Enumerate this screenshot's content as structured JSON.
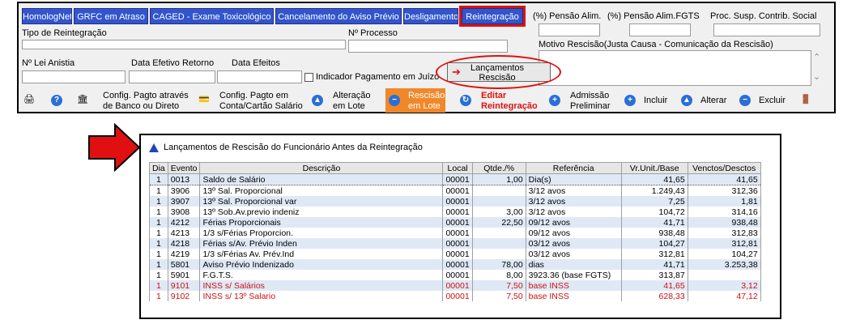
{
  "tabs": [
    {
      "label": "HomologNet"
    },
    {
      "label": "GRFC em Atraso"
    },
    {
      "label": "CAGED - Exame Toxicológico"
    },
    {
      "label": "Cancelamento do Aviso Prévio"
    },
    {
      "label": "Desligamento"
    },
    {
      "label": "Reintegração"
    }
  ],
  "form": {
    "tipo_reintegracao_label": "Tipo de Reintegração",
    "n_processo_label": "Nº Processo",
    "pensao_alim_label": "(%) Pensão Alim.",
    "pensao_fgts_label": "(%) Pensão Alim.FGTS",
    "proc_susp_label": "Proc. Susp. Contrib. Social",
    "motivo_label": "Motivo Rescisão(Justa Causa - Comunicação da Rescisão)",
    "lei_anistia_label": "Nº Lei Anistia",
    "data_retorno_label": "Data Efetivo Retorno",
    "data_efeitos_label": "Data Efeitos",
    "indicador_label": "Indicador Pagamento em Juízo",
    "lancamentos_line1": "Lançamentos",
    "lancamentos_line2": "Rescisão"
  },
  "toolbar": {
    "config_banco_1": "Config. Pagto através",
    "config_banco_2": "de Banco ou Direto",
    "config_conta_1": "Config. Pagto em",
    "config_conta_2": "Conta/Cartão Salário",
    "alteracao_1": "Alteração",
    "alteracao_2": "em Lote",
    "rescisao_1": "Rescisão",
    "rescisao_2": "em Lote",
    "editar_1": "Editar",
    "editar_2": "Reintegração",
    "admissao_1": "Admissão",
    "admissao_2": "Preliminar",
    "incluir": "Incluir",
    "alterar": "Alterar",
    "excluir": "Excluir"
  },
  "panel": {
    "title": "Lançamentos de Rescisão do Funcionário Antes da Reintegração"
  },
  "table": {
    "headers": [
      "Dia",
      "Evento",
      "Descrição",
      "Local",
      "Qtde./%",
      "Referência",
      "Vr.Unit./Base",
      "Venctos/Desctos"
    ],
    "rows": [
      {
        "dia": "1",
        "evento": "0013",
        "descricao": "Saldo de Salário",
        "local": "00001",
        "qtde": "1,00",
        "referencia": "Dia(s)",
        "vrunit": "41,65",
        "venctos": "41,65",
        "style": "sel"
      },
      {
        "dia": "1",
        "evento": "3906",
        "descricao": "13º Sal. Proporcional",
        "local": "00001",
        "qtde": "",
        "referencia": "3/12 avos",
        "vrunit": "1.249,43",
        "venctos": "312,36",
        "style": "even"
      },
      {
        "dia": "1",
        "evento": "3907",
        "descricao": "13º Sal. Proporcional var",
        "local": "00001",
        "qtde": "",
        "referencia": "3/12 avos",
        "vrunit": "7,25",
        "venctos": "1,81",
        "style": "odd"
      },
      {
        "dia": "1",
        "evento": "3908",
        "descricao": "13º Sob.Av.previo indeniz",
        "local": "00001",
        "qtde": "3,00",
        "referencia": "3/12 avos",
        "vrunit": "104,72",
        "venctos": "314,16",
        "style": "even"
      },
      {
        "dia": "1",
        "evento": "4212",
        "descricao": "Férias Proporcionais",
        "local": "00001",
        "qtde": "22,50",
        "referencia": "09/12 avos",
        "vrunit": "41,71",
        "venctos": "938,48",
        "style": "odd"
      },
      {
        "dia": "1",
        "evento": "4213",
        "descricao": "1/3 s/Férias Proporcion.",
        "local": "00001",
        "qtde": "",
        "referencia": "09/12 avos",
        "vrunit": "938,48",
        "venctos": "312,83",
        "style": "even"
      },
      {
        "dia": "1",
        "evento": "4218",
        "descricao": "Férias s/Av. Prévio Inden",
        "local": "00001",
        "qtde": "",
        "referencia": "03/12 avos",
        "vrunit": "104,27",
        "venctos": "312,81",
        "style": "odd"
      },
      {
        "dia": "1",
        "evento": "4219",
        "descricao": "1/3 s/Férias Av. Prév.Ind",
        "local": "00001",
        "qtde": "",
        "referencia": "03/12 avos",
        "vrunit": "312,81",
        "venctos": "104,27",
        "style": "even"
      },
      {
        "dia": "1",
        "evento": "5801",
        "descricao": "Aviso Prévio Indenizado",
        "local": "00001",
        "qtde": "78,00",
        "referencia": "dias",
        "vrunit": "41,71",
        "venctos": "3.253,38",
        "style": "odd"
      },
      {
        "dia": "1",
        "evento": "5901",
        "descricao": "F.G.T.S.",
        "local": "00001",
        "qtde": "8,00",
        "referencia": "3923.36 (base FGTS)",
        "vrunit": "313,87",
        "venctos": "",
        "style": "even"
      },
      {
        "dia": "1",
        "evento": "9101",
        "descricao": "INSS s/ Salários",
        "local": "00001",
        "qtde": "7,50",
        "referencia": "base INSS",
        "vrunit": "41,65",
        "venctos": "3,12",
        "style": "odd neg"
      },
      {
        "dia": "1",
        "evento": "9102",
        "descricao": "INSS s/ 13º Salario",
        "local": "00001",
        "qtde": "7,50",
        "referencia": "base INSS",
        "vrunit": "628,33",
        "venctos": "47,12",
        "style": "even neg"
      }
    ]
  },
  "colors": {
    "tab_blue": "#3355cc",
    "highlight_red": "#e01010",
    "row_blue": "#dfe9f6",
    "orange_button": "#f0882a"
  }
}
